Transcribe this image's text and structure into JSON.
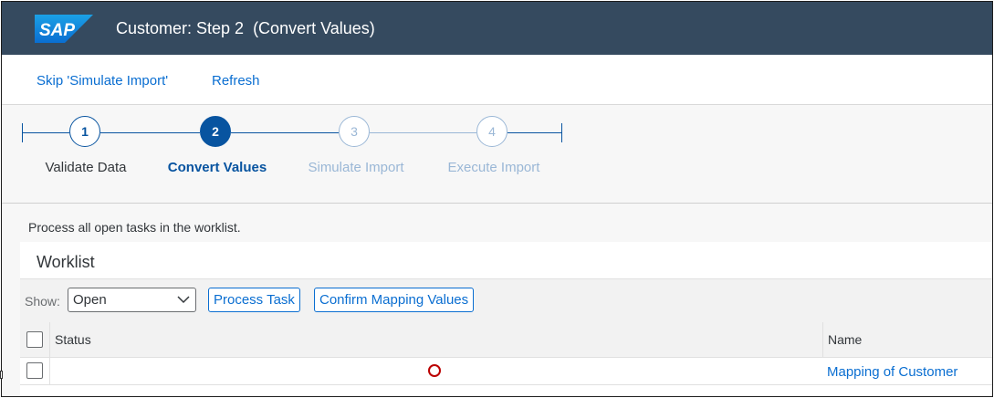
{
  "shell": {
    "logo_text": "SAP",
    "title": "Customer: Step 2  (Convert Values)",
    "color": "#354a5f"
  },
  "toolbar": {
    "skip_label": "Skip 'Simulate Import'",
    "refresh_label": "Refresh"
  },
  "wizard": {
    "steps": [
      {
        "number": "1",
        "label": "Validate Data",
        "state": "completed"
      },
      {
        "number": "2",
        "label": "Convert Values",
        "state": "active"
      },
      {
        "number": "3",
        "label": "Simulate Import",
        "state": "disabled"
      },
      {
        "number": "4",
        "label": "Execute Import",
        "state": "disabled"
      }
    ],
    "accent": "#0854a0"
  },
  "content": {
    "info_text": "Process all open tasks in the worklist.",
    "worklist": {
      "title": "Worklist",
      "show_label": "Show:",
      "show_value": "Open",
      "process_task_label": "Process Task",
      "confirm_mapping_label": "Confirm Mapping Values",
      "columns": {
        "status": "Status",
        "name": "Name"
      },
      "rows": [
        {
          "status_icon": "open-circle-icon",
          "status_color": "#bb0000",
          "name": "Mapping of Customer"
        }
      ]
    }
  }
}
